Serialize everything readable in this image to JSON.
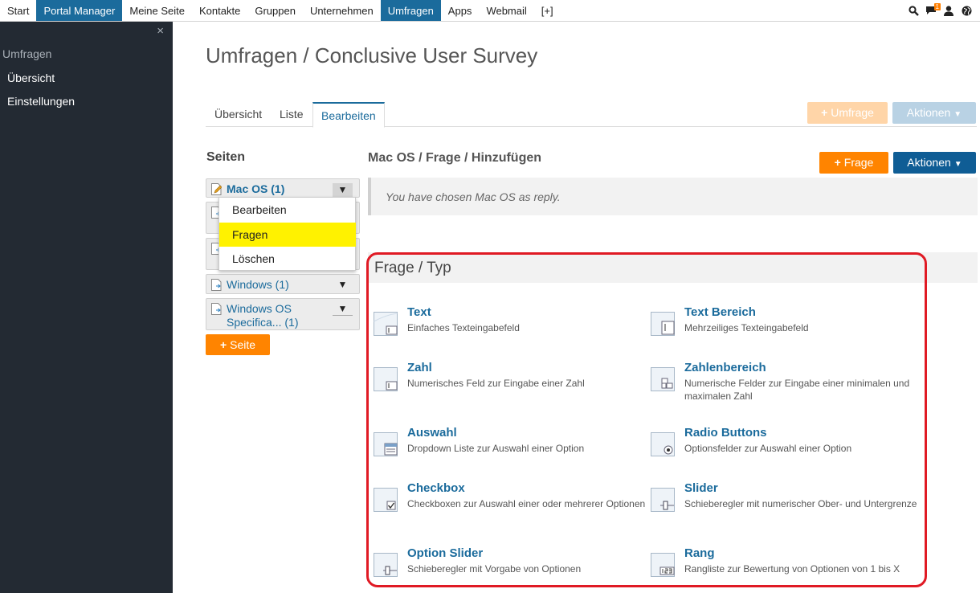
{
  "topnav": {
    "items": [
      {
        "label": "Start",
        "active": false
      },
      {
        "label": "Portal Manager",
        "active": true
      },
      {
        "label": "Meine Seite",
        "active": false
      },
      {
        "label": "Kontakte",
        "active": false
      },
      {
        "label": "Gruppen",
        "active": false
      },
      {
        "label": "Unternehmen",
        "active": false
      },
      {
        "label": "Umfragen",
        "active": true
      },
      {
        "label": "Apps",
        "active": false
      },
      {
        "label": "Webmail",
        "active": false
      },
      {
        "label": "[+]",
        "active": false
      }
    ],
    "message_badge": "1",
    "icons": [
      "search-icon",
      "chat-icon",
      "user-icon",
      "globe-icon"
    ]
  },
  "sidebar": {
    "close": "×",
    "title": "Umfragen",
    "items": [
      {
        "label": "Übersicht"
      },
      {
        "label": "Einstellungen"
      }
    ]
  },
  "main": {
    "title": "Umfragen / Conclusive User Survey",
    "tabs": [
      {
        "label": "Übersicht"
      },
      {
        "label": "Liste"
      },
      {
        "label": "Bearbeiten"
      }
    ],
    "top_buttons": {
      "umfrage": "Umfrage",
      "aktionen": "Aktionen"
    }
  },
  "seiten": {
    "title": "Seiten",
    "pages": [
      {
        "label": "Mac OS (1)"
      },
      {
        "label": ""
      },
      {
        "label": ""
      },
      {
        "label": "Windows (1)"
      },
      {
        "label": "Windows OS Specifica... (1)"
      }
    ],
    "dropdown": [
      {
        "label": "Bearbeiten"
      },
      {
        "label": "Fragen"
      },
      {
        "label": "Löschen"
      }
    ],
    "add_button": "Seite"
  },
  "editor": {
    "breadcrumb": "Mac OS / Frage / Hinzufügen",
    "frage_button": "Frage",
    "aktionen_button": "Aktionen",
    "notice": "You have chosen Mac OS as reply.",
    "panel_title": "Frage / Typ",
    "types": [
      {
        "name": "Text",
        "desc": "Einfaches Texteingabefeld"
      },
      {
        "name": "Text Bereich",
        "desc": "Mehrzeiliges Texteingabefeld"
      },
      {
        "name": "Zahl",
        "desc": "Numerisches Feld zur Eingabe einer Zahl"
      },
      {
        "name": "Zahlenbereich",
        "desc": "Numerische Felder zur Eingabe einer minimalen und maximalen Zahl"
      },
      {
        "name": "Auswahl",
        "desc": "Dropdown Liste zur Auswahl einer Option"
      },
      {
        "name": "Radio Buttons",
        "desc": "Optionsfelder zur Auswahl einer Option"
      },
      {
        "name": "Checkbox",
        "desc": "Checkboxen zur Auswahl einer oder mehrerer Optionen"
      },
      {
        "name": "Slider",
        "desc": "Schieberegler mit numerischer Ober- und Untergrenze"
      },
      {
        "name": "Option Slider",
        "desc": "Schieberegler mit Vorgabe von Optionen"
      },
      {
        "name": "Rang",
        "desc": "Rangliste zur Bewertung von Optionen von 1 bis X"
      }
    ]
  },
  "colors": {
    "accent": "#1b6b9c",
    "orange": "#ff8400",
    "highlight": "#fff200",
    "annotation": "#e01a24"
  }
}
